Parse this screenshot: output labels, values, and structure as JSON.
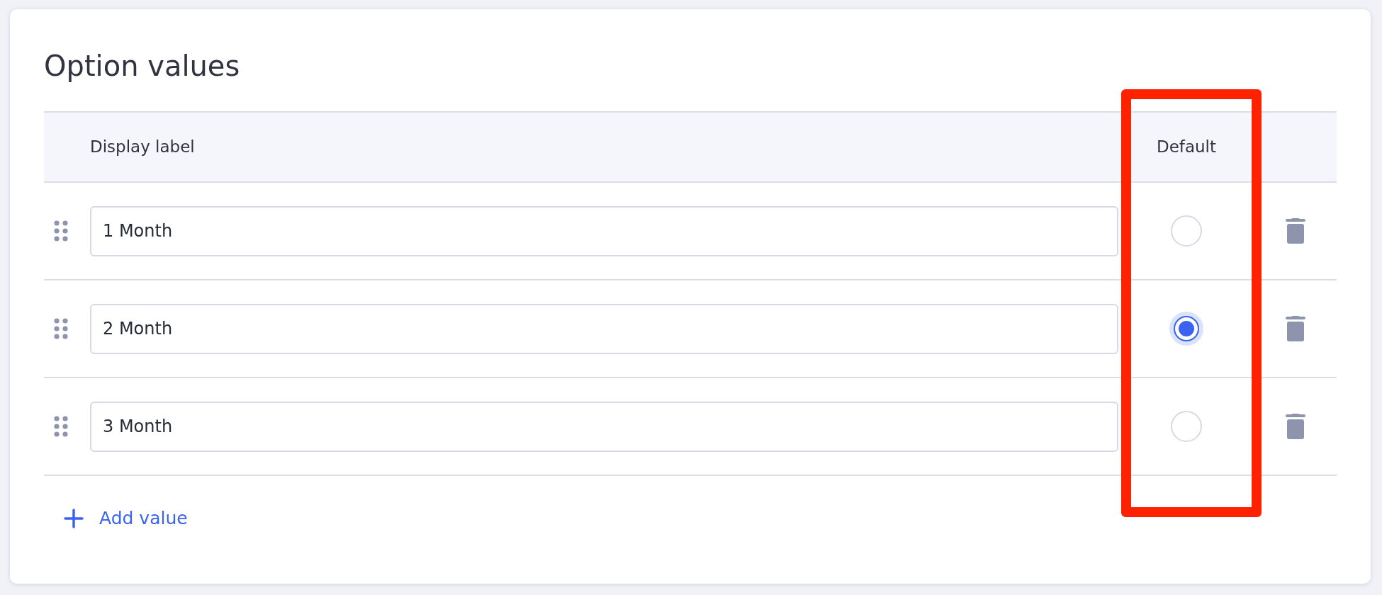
{
  "section": {
    "title": "Option values"
  },
  "table": {
    "columns": [
      "Display label",
      "Default"
    ],
    "rows": [
      {
        "label": "1 Month",
        "selected": false
      },
      {
        "label": "2 Month",
        "selected": true
      },
      {
        "label": "3 Month",
        "selected": false
      }
    ]
  },
  "add_button": {
    "label": "Add value"
  }
}
